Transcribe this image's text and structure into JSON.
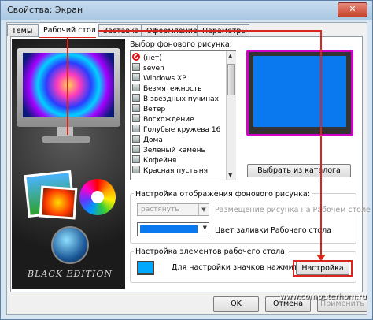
{
  "window": {
    "title": "Свойства: Экран",
    "close_glyph": "✕"
  },
  "tabs": [
    {
      "label": "Темы"
    },
    {
      "label": "Рабочий стол"
    },
    {
      "label": "Заставка"
    },
    {
      "label": "Оформление"
    },
    {
      "label": "Параметры"
    }
  ],
  "preview": {
    "brand": "BLACK EDITION"
  },
  "background_list": {
    "label": "Выбор фонового рисунка:",
    "items": [
      "(нет)",
      "seven",
      "Windows XP",
      "Безмятежность",
      "В звездных пучинах",
      "Ветер",
      "Восхождение",
      "Голубые кружева 16",
      "Дома",
      "Зеленый камень",
      "Кофейня",
      "Красная пустыня"
    ]
  },
  "catalog_button": "Выбрать из каталога",
  "display_group": {
    "label": "Настройка отображения фонового рисунка:",
    "position_value": "растянуть",
    "position_label": "Размещение рисунка на Рабочем столе",
    "color_label": "Цвет заливки Рабочего стола",
    "fill_color": "#0a79ef"
  },
  "desktop_items_group": {
    "label": "Настройка элементов рабочего стола:",
    "hint": "Для настройки значков нажмите:",
    "button": "Настройка"
  },
  "footer": {
    "ok": "OK",
    "cancel": "Отмена",
    "apply": "Применить"
  },
  "watermark": "www.computerhom.ru",
  "accent_color": "#d8261f"
}
